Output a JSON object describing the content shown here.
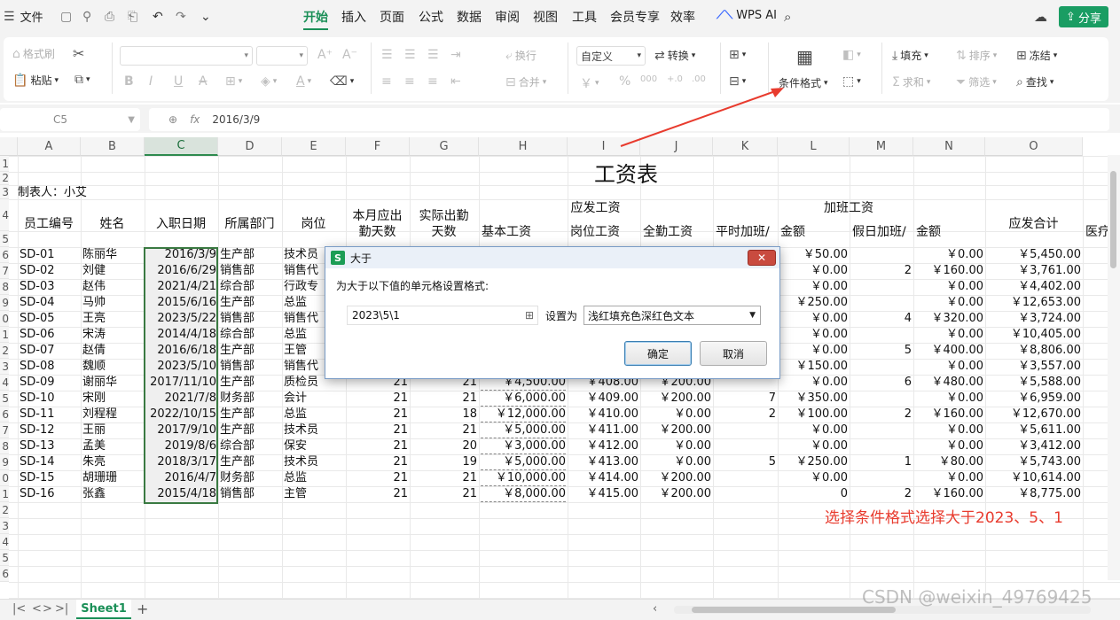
{
  "titlebar": {
    "file_menu": "文件",
    "tabs": [
      "开始",
      "插入",
      "页面",
      "公式",
      "数据",
      "审阅",
      "视图",
      "工具",
      "会员专享",
      "效率"
    ],
    "active_tab": "开始",
    "wps_ai": "WPS AI",
    "share": "分享"
  },
  "ribbon": {
    "format_painter": "格式刷",
    "paste": "粘贴",
    "wrap": "换行",
    "number_format": "自定义",
    "convert": "转换",
    "merge": "合并",
    "conditional_format": "条件格式",
    "fill": "填充",
    "sort": "排序",
    "freeze": "冻结",
    "sum": "求和",
    "filter": "筛选",
    "find": "查找"
  },
  "formula_bar": {
    "cell_ref": "C5",
    "fx": "fx",
    "value": "2016/3/9"
  },
  "grid": {
    "columns": [
      "A",
      "B",
      "C",
      "D",
      "E",
      "F",
      "G",
      "H",
      "I",
      "J",
      "K",
      "L",
      "M",
      "N",
      "O"
    ],
    "selected_column": "C",
    "row_numbers": [
      "1",
      "2",
      "3",
      "4",
      "5",
      "6",
      "7",
      "8",
      "9",
      "0",
      "1",
      "2",
      "3",
      "4",
      "5",
      "6",
      "7",
      "8",
      "9",
      "0",
      "1",
      "2",
      "3",
      "4",
      "5",
      "6"
    ],
    "sheet_title": "工资表",
    "maker": "制表人：小艾",
    "headers": {
      "emp_id": "员工编号",
      "name": "姓名",
      "hire_date": "入职日期",
      "dept": "所属部门",
      "position": "岗位",
      "due_days_1": "本月应出",
      "due_days_2": "勤天数",
      "actual_days_1": "实际出勤",
      "actual_days_2": "天数",
      "payable": "应发工资",
      "base": "基本工资",
      "post_pay": "岗位工资",
      "attendance": "全勤工资",
      "overtime": "加班工资",
      "weekday_ot": "平时加班/",
      "amount1": "金额",
      "holiday_ot": "假日加班/",
      "amount2": "金额",
      "total": "应发合计",
      "medical": "医疗"
    },
    "rows": [
      {
        "id": "SD-01",
        "name": "陈丽华",
        "date": "2016/3/9",
        "dept": "生产部",
        "pos": "技术员",
        "due": "",
        "act": "",
        "base": "",
        "post": "",
        "att": "",
        "wk": "",
        "wkamt": "￥50.00",
        "hol": "",
        "holamt": "￥0.00",
        "total": "￥5,450.00"
      },
      {
        "id": "SD-02",
        "name": "刘健",
        "date": "2016/6/29",
        "dept": "销售部",
        "pos": "销售代",
        "due": "",
        "act": "",
        "base": "",
        "post": "",
        "att": "",
        "wk": "",
        "wkamt": "￥0.00",
        "hol": "2",
        "holamt": "￥160.00",
        "total": "￥3,761.00"
      },
      {
        "id": "SD-03",
        "name": "赵伟",
        "date": "2021/4/21",
        "dept": "综合部",
        "pos": "行政专",
        "due": "",
        "act": "",
        "base": "",
        "post": "",
        "att": "",
        "wk": "",
        "wkamt": "￥0.00",
        "hol": "",
        "holamt": "￥0.00",
        "total": "￥4,402.00"
      },
      {
        "id": "SD-04",
        "name": "马帅",
        "date": "2015/6/16",
        "dept": "生产部",
        "pos": "总监",
        "due": "",
        "act": "",
        "base": "",
        "post": "",
        "att": "",
        "wk": "",
        "wkamt": "￥250.00",
        "hol": "",
        "holamt": "￥0.00",
        "total": "￥12,653.00"
      },
      {
        "id": "SD-05",
        "name": "王亮",
        "date": "2023/5/22",
        "dept": "销售部",
        "pos": "销售代",
        "due": "",
        "act": "",
        "base": "",
        "post": "",
        "att": "",
        "wk": "",
        "wkamt": "￥0.00",
        "hol": "4",
        "holamt": "￥320.00",
        "total": "￥3,724.00"
      },
      {
        "id": "SD-06",
        "name": "宋涛",
        "date": "2014/4/18",
        "dept": "综合部",
        "pos": "总监",
        "due": "",
        "act": "",
        "base": "",
        "post": "",
        "att": "",
        "wk": "",
        "wkamt": "￥0.00",
        "hol": "",
        "holamt": "￥0.00",
        "total": "￥10,405.00"
      },
      {
        "id": "SD-07",
        "name": "赵倩",
        "date": "2016/6/18",
        "dept": "生产部",
        "pos": "王管",
        "due": "",
        "act": "",
        "base": "",
        "post": "",
        "att": "",
        "wk": "",
        "wkamt": "￥0.00",
        "hol": "5",
        "holamt": "￥400.00",
        "total": "￥8,806.00"
      },
      {
        "id": "SD-08",
        "name": "魏顺",
        "date": "2023/5/10",
        "dept": "销售部",
        "pos": "销售代",
        "due": "",
        "act": "",
        "base": "",
        "post": "",
        "att": "",
        "wk": "",
        "wkamt": "￥150.00",
        "hol": "",
        "holamt": "￥0.00",
        "total": "￥3,557.00"
      },
      {
        "id": "SD-09",
        "name": "谢丽华",
        "date": "2017/11/10",
        "dept": "生产部",
        "pos": "质检员",
        "due": "21",
        "act": "21",
        "base": "￥4,500.00",
        "post": "￥408.00",
        "att": "￥200.00",
        "wk": "",
        "wkamt": "￥0.00",
        "hol": "6",
        "holamt": "￥480.00",
        "total": "￥5,588.00"
      },
      {
        "id": "SD-10",
        "name": "宋刚",
        "date": "2021/7/8",
        "dept": "财务部",
        "pos": "会计",
        "due": "21",
        "act": "21",
        "base": "￥6,000.00",
        "post": "￥409.00",
        "att": "￥200.00",
        "wk": "7",
        "wkamt": "￥350.00",
        "hol": "",
        "holamt": "￥0.00",
        "total": "￥6,959.00"
      },
      {
        "id": "SD-11",
        "name": "刘程程",
        "date": "2022/10/15",
        "dept": "生产部",
        "pos": "总监",
        "due": "21",
        "act": "18",
        "base": "￥12,000.00",
        "post": "￥410.00",
        "att": "￥0.00",
        "wk": "2",
        "wkamt": "￥100.00",
        "hol": "2",
        "holamt": "￥160.00",
        "total": "￥12,670.00"
      },
      {
        "id": "SD-12",
        "name": "王丽",
        "date": "2017/9/10",
        "dept": "生产部",
        "pos": "技术员",
        "due": "21",
        "act": "21",
        "base": "￥5,000.00",
        "post": "￥411.00",
        "att": "￥200.00",
        "wk": "",
        "wkamt": "￥0.00",
        "hol": "",
        "holamt": "￥0.00",
        "total": "￥5,611.00"
      },
      {
        "id": "SD-13",
        "name": "孟美",
        "date": "2019/8/6",
        "dept": "综合部",
        "pos": "保安",
        "due": "21",
        "act": "20",
        "base": "￥3,000.00",
        "post": "￥412.00",
        "att": "￥0.00",
        "wk": "",
        "wkamt": "￥0.00",
        "hol": "",
        "holamt": "￥0.00",
        "total": "￥3,412.00"
      },
      {
        "id": "SD-14",
        "name": "朱亮",
        "date": "2018/3/17",
        "dept": "生产部",
        "pos": "技术员",
        "due": "21",
        "act": "19",
        "base": "￥5,000.00",
        "post": "￥413.00",
        "att": "￥0.00",
        "wk": "5",
        "wkamt": "￥250.00",
        "hol": "1",
        "holamt": "￥80.00",
        "total": "￥5,743.00"
      },
      {
        "id": "SD-15",
        "name": "胡珊珊",
        "date": "2016/4/7",
        "dept": "财务部",
        "pos": "总监",
        "due": "21",
        "act": "21",
        "base": "￥10,000.00",
        "post": "￥414.00",
        "att": "￥200.00",
        "wk": "",
        "wkamt": "￥0.00",
        "hol": "",
        "holamt": "￥0.00",
        "total": "￥10,614.00"
      },
      {
        "id": "SD-16",
        "name": "张鑫",
        "date": "2015/4/18",
        "dept": "销售部",
        "pos": "主管",
        "due": "21",
        "act": "21",
        "base": "￥8,000.00",
        "post": "￥415.00",
        "att": "￥200.00",
        "wk": "",
        "wkamt": "0",
        "hol": "2",
        "holamt": "￥160.00",
        "total": "￥8,775.00"
      }
    ]
  },
  "dialog": {
    "title": "大于",
    "close": "✕",
    "prompt": "为大于以下值的单元格设置格式:",
    "value": "2023\\5\\1",
    "set_as": "设置为",
    "format_option": "浅红填充色深红色文本",
    "ok": "确定",
    "cancel": "取消"
  },
  "annotation": "选择条件格式选择大于2023、5、1",
  "bottom": {
    "sheet_name": "Sheet1",
    "add": "+"
  },
  "watermark": "CSDN @weixin_49769425",
  "colors": {
    "accent": "#1a8f57",
    "annotation": "#e83b2e",
    "selection_border": "#3a7a42"
  }
}
